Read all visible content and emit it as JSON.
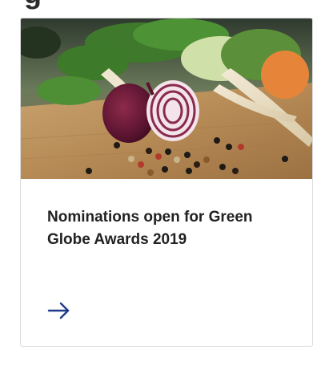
{
  "card": {
    "title": "Nominations open for Green Globe Awards 2019",
    "image_alt_icon": "vegetables-photo",
    "arrow_icon": "arrow-right-icon",
    "accent_color": "#1f3b8a"
  }
}
